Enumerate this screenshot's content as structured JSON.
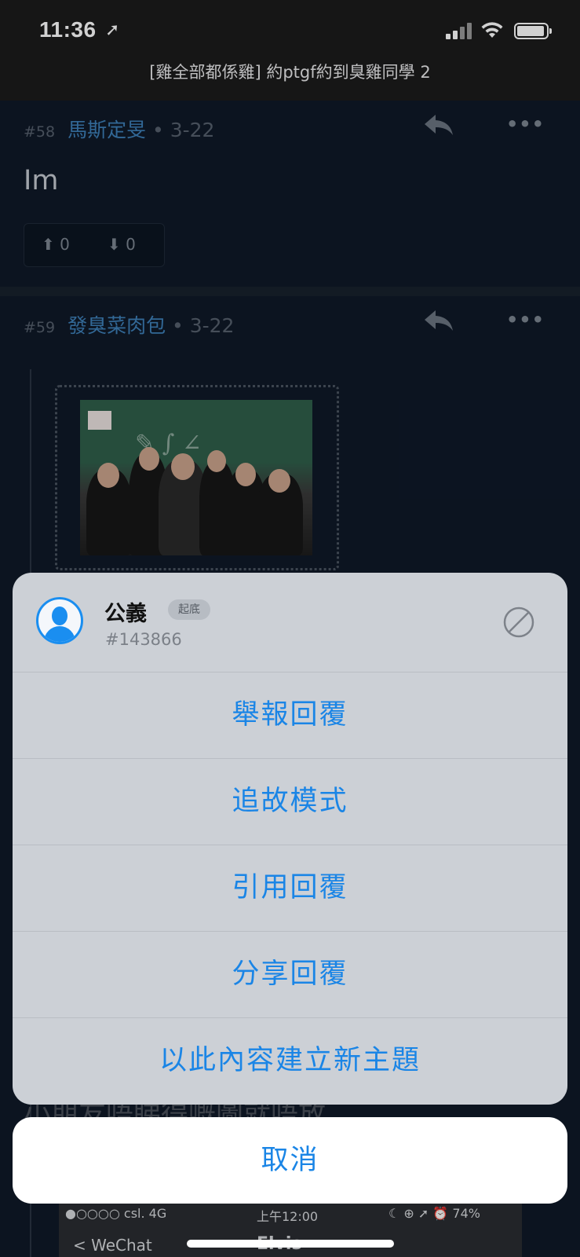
{
  "status_bar": {
    "time": "11:36",
    "location_icon": "location-arrow-icon",
    "signal_icon": "cellular-signal-icon",
    "wifi_icon": "wifi-icon",
    "battery_icon": "battery-icon"
  },
  "thread": {
    "title": "[雞全部都係雞] 約ptgf約到臭雞同學 2"
  },
  "posts": [
    {
      "number": "#58",
      "user": "馬斯定旻",
      "date": "• 3-22",
      "body": "Im",
      "upvotes": "0",
      "downvotes": "0"
    },
    {
      "number": "#59",
      "user": "發臭菜肉包",
      "date": "• 3-22"
    }
  ],
  "background_partial_text": "小朋友唔睇得嘅圖就唔放",
  "embedded_screenshot": {
    "carrier": "●○○○○ csl.  4G",
    "time": "上午12:00",
    "battery": "☾ ⊕ ➚ ⏰ 74%",
    "back_label": "< WeChat",
    "contact": "Elvis"
  },
  "action_sheet": {
    "user_name": "公義",
    "user_badge": "起底",
    "user_id": "#143866",
    "items": [
      {
        "label": "舉報回覆"
      },
      {
        "label": "追故模式"
      },
      {
        "label": "引用回覆"
      },
      {
        "label": "分享回覆"
      },
      {
        "label": "以此內容建立新主題"
      }
    ],
    "cancel_label": "取消"
  },
  "colors": {
    "accent": "#1a85e6",
    "sheet_background": "#ccd0d6",
    "page_background": "#0d1522"
  }
}
